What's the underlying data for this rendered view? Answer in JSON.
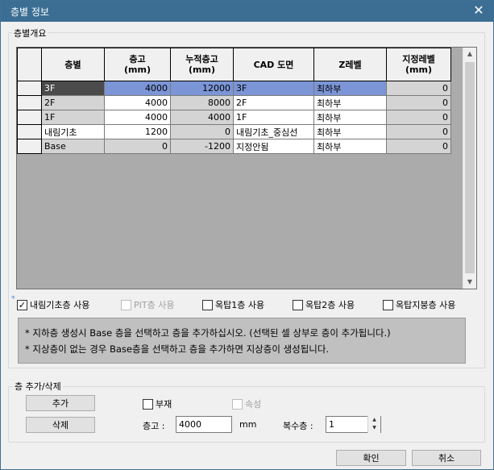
{
  "window": {
    "title": "층별 정보",
    "close_glyph": "✕"
  },
  "group_overview": {
    "label": "층별개요"
  },
  "table": {
    "headers": [
      "층별",
      "층고\n(mm)",
      "누적층고\n(mm)",
      "CAD 도면",
      "Z레벨",
      "지정레벨\n(mm)"
    ],
    "rows": [
      {
        "name": "3F",
        "height": "4000",
        "cumulative": "12000",
        "cad": "3F",
        "z": "최하부",
        "level": "0",
        "selected": true
      },
      {
        "name": "2F",
        "height": "4000",
        "cumulative": "8000",
        "cad": "2F",
        "z": "최하부",
        "level": "0",
        "selected": false
      },
      {
        "name": "1F",
        "height": "4000",
        "cumulative": "4000",
        "cad": "1F",
        "z": "최하부",
        "level": "0",
        "selected": false
      },
      {
        "name": "내림기초",
        "height": "1200",
        "cumulative": "0",
        "cad": "내림기초_중심선",
        "z": "최하부",
        "level": "0",
        "selected": false
      },
      {
        "name": "Base",
        "height": "0",
        "cumulative": "-1200",
        "cad": "지정안됨",
        "z": "최하부",
        "level": "0",
        "selected": false
      }
    ]
  },
  "options": {
    "asterisk": "*",
    "use_drop_foundation": {
      "label": "내림기초층 사용",
      "checked": true
    },
    "use_pit": {
      "label": "PIT층 사용",
      "checked": false,
      "disabled": true
    },
    "use_rooftop1": {
      "label": "옥탑1층 사용",
      "checked": false
    },
    "use_rooftop2": {
      "label": "옥탑2층 사용",
      "checked": false
    },
    "use_rooftop_roof": {
      "label": "옥탑지붕층 사용",
      "checked": false
    }
  },
  "notes": [
    "* 지하층 생성시 Base 층을 선택하고 층을 추가하십시오. (선택된 셀 상부로 층이 추가됩니다.)",
    "* 지상층이 없는 경우 Base층을 선택하고 층을 추가하면 지상층이 생성됩니다."
  ],
  "group_add_delete": {
    "label": "층 추가/삭제"
  },
  "add_button": "추가",
  "delete_button": "삭제",
  "member": {
    "label": "부재",
    "checked": false
  },
  "attribute": {
    "label": "속성",
    "checked": false,
    "disabled": true
  },
  "floor_height": {
    "label": "층고 :",
    "value": "4000",
    "unit": "mm"
  },
  "multi_floor": {
    "label": "복수층 :",
    "value": "1"
  },
  "ok_button": "확인",
  "cancel_button": "취소"
}
